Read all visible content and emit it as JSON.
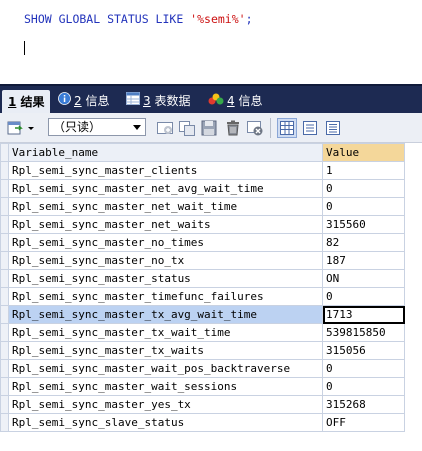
{
  "editor": {
    "sql_keyword": "SHOW GLOBAL STATUS LIKE ",
    "sql_string": "'%semi%'",
    "sql_end": ";"
  },
  "tabs": [
    {
      "num": "1",
      "label": "结果",
      "icon": "grid-result-icon",
      "active": true
    },
    {
      "num": "2",
      "label": "信息",
      "icon": "info-icon",
      "active": false
    },
    {
      "num": "3",
      "label": "表数据",
      "icon": "table-data-icon",
      "active": false
    },
    {
      "num": "4",
      "label": "信息",
      "icon": "info-flag-icon",
      "active": false
    }
  ],
  "toolbar": {
    "mode_value": "（只读）"
  },
  "grid": {
    "columns": [
      "Variable_name",
      "Value"
    ],
    "rows": [
      {
        "name": "Rpl_semi_sync_master_clients",
        "value": "1"
      },
      {
        "name": "Rpl_semi_sync_master_net_avg_wait_time",
        "value": "0"
      },
      {
        "name": "Rpl_semi_sync_master_net_wait_time",
        "value": "0"
      },
      {
        "name": "Rpl_semi_sync_master_net_waits",
        "value": "315560"
      },
      {
        "name": "Rpl_semi_sync_master_no_times",
        "value": "82"
      },
      {
        "name": "Rpl_semi_sync_master_no_tx",
        "value": "187"
      },
      {
        "name": "Rpl_semi_sync_master_status",
        "value": "ON"
      },
      {
        "name": "Rpl_semi_sync_master_timefunc_failures",
        "value": "0"
      },
      {
        "name": "Rpl_semi_sync_master_tx_avg_wait_time",
        "value": "1713",
        "selected": true
      },
      {
        "name": "Rpl_semi_sync_master_tx_wait_time",
        "value": "539815850"
      },
      {
        "name": "Rpl_semi_sync_master_tx_waits",
        "value": "315056"
      },
      {
        "name": "Rpl_semi_sync_master_wait_pos_backtraverse",
        "value": "0"
      },
      {
        "name": "Rpl_semi_sync_master_wait_sessions",
        "value": "0"
      },
      {
        "name": "Rpl_semi_sync_master_yes_tx",
        "value": "315268"
      },
      {
        "name": "Rpl_semi_sync_slave_status",
        "value": "OFF"
      }
    ]
  },
  "colors": {
    "tabbar_bg": "#1d2a52",
    "header_value_bg": "#f4d79a",
    "selected_cell_bg": "#bcd2f2",
    "sql_keyword": "#2233bb",
    "sql_string": "#cc1111"
  }
}
